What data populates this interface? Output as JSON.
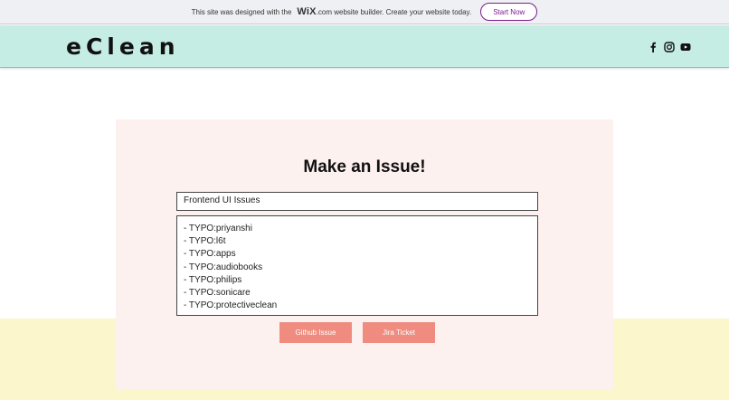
{
  "banner": {
    "text_before": "This site was designed with the",
    "wix_logo": "WiX",
    "text_after": ".com website builder. Create your website today.",
    "cta_label": "Start Now"
  },
  "header": {
    "brand": "eClean",
    "social_icons": [
      "facebook-icon",
      "instagram-icon",
      "youtube-icon"
    ]
  },
  "form": {
    "title": "Make an Issue!",
    "issue_title_value": "Frontend UI Issues",
    "issue_body_lines": [
      "- TYPO:priyanshi",
      "- TYPO:l6t",
      "- TYPO:apps",
      "- TYPO:audiobooks",
      "- TYPO:philips",
      "- TYPO:sonicare",
      "- TYPO:protectiveclean"
    ],
    "github_button": "Github Issue",
    "jira_button": "Jira Ticket"
  },
  "colors": {
    "header_bg": "#c5ede3",
    "card_bg": "#fdf1f0",
    "lower_band": "#fbf6cc",
    "button": "#ef8c7f",
    "cta_accent": "#7b1c8e"
  }
}
